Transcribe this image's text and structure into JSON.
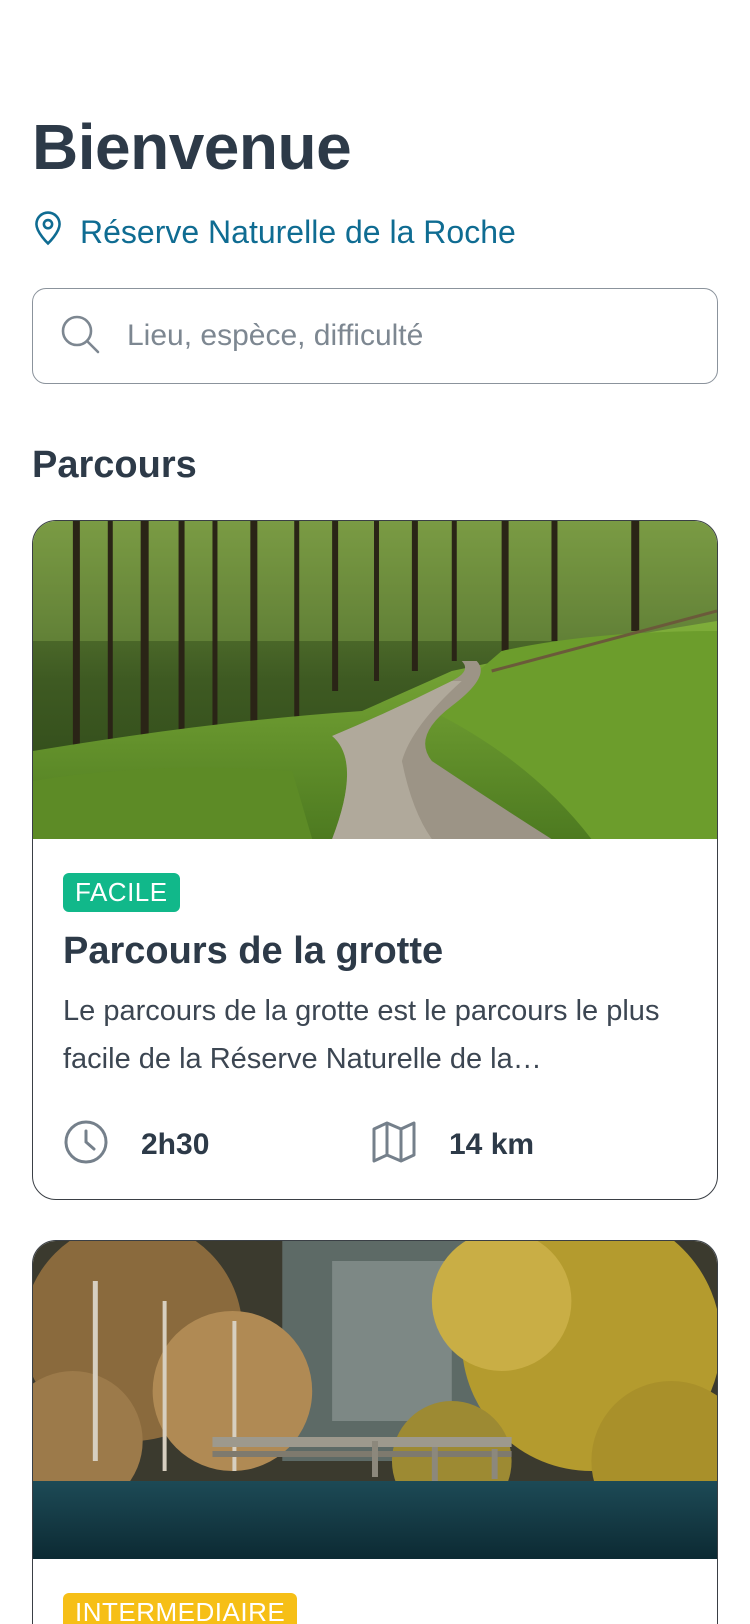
{
  "header": {
    "title": "Bienvenue",
    "location": "Réserve Naturelle de la Roche",
    "location_icon": "map-pin-icon"
  },
  "search": {
    "placeholder": "Lieu, espèce, difficulté",
    "value": "",
    "icon": "search-icon"
  },
  "section": {
    "title": "Parcours"
  },
  "cards": [
    {
      "badge": "FACILE",
      "badge_color": "#11b88a",
      "title": "Parcours de la grotte",
      "description": "Le parcours de la grotte est le parcours le plus facile de la Réserve Naturelle de la…",
      "duration": "2h30",
      "duration_icon": "clock-icon",
      "distance": "14 km",
      "distance_icon": "map-icon",
      "image": "forest-path-photo"
    },
    {
      "badge": "INTERMEDIAIRE",
      "badge_color": "#f6bf16",
      "image": "lake-bridge-photo"
    }
  ],
  "colors": {
    "text": "#2d3a48",
    "accent": "#0f6c92",
    "border": "#8b939c"
  }
}
